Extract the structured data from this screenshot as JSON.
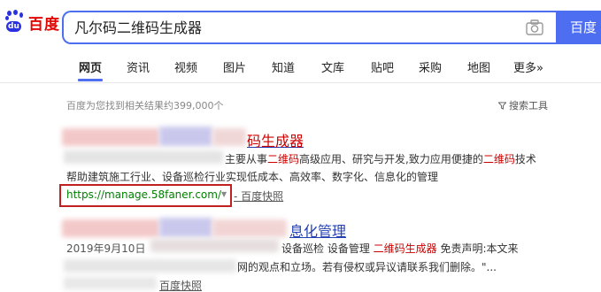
{
  "header": {
    "logo_text": "百度",
    "logo_du": "du",
    "search_value": "凡尔码二维码生成器",
    "search_button": "百度"
  },
  "tabs": [
    "网页",
    "资讯",
    "视频",
    "图片",
    "知道",
    "文库",
    "贴吧",
    "采购",
    "地图",
    "更多»"
  ],
  "active_tab": "网页",
  "stats_text": "百度为您找到相关结果约399,000个",
  "tools_label": "搜索工具",
  "results": [
    {
      "title_visible": "码生成器",
      "snippet_line1_a": "主要从事",
      "snippet_line1_b": "二维码",
      "snippet_line1_c": "高级应用、研究与开发,致力应用便捷的",
      "snippet_line1_d": "二维码",
      "snippet_line1_e": "技术",
      "snippet_line2": "帮助建筑施工行业、设备巡检行业实现低成本、高效率、数字化、信息化的管理",
      "url": "https://manage.58faner.com/",
      "url_arrow": "▼",
      "snapshot": "- 百度快照"
    },
    {
      "title_visible": "息化管理",
      "date": "2019年9月10日",
      "snippet_line1_a": "设备巡检 设备管理",
      "snippet_line1_b": "二维码生成器",
      "snippet_line1_c": "免责声明:本文来",
      "snippet_line2": "网的观点和立场。若有侵权或异议请联系我们删除。\"...",
      "snapshot": "百度快照"
    }
  ],
  "colors": {
    "accent": "#4e6ef2",
    "brand_red": "#e10602",
    "link": "#2440b3",
    "highlight": "#cc0000",
    "url_green": "#008000",
    "annotation_box": "#c02020"
  }
}
